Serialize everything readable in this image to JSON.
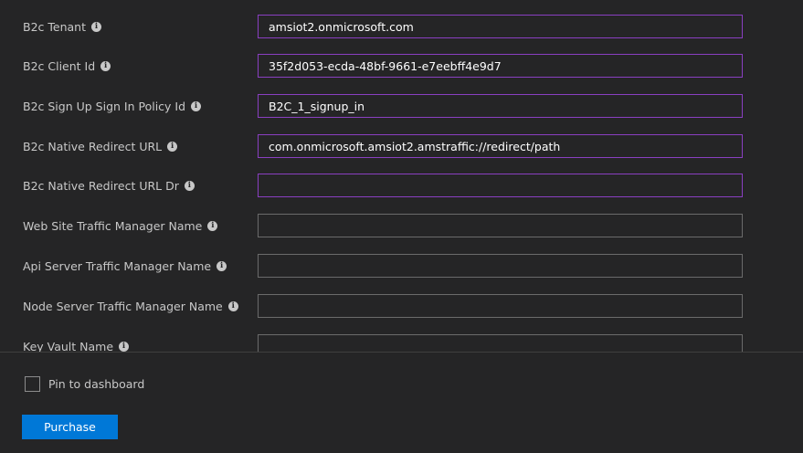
{
  "form": {
    "fields": [
      {
        "label": "B2c Tenant",
        "value": "amsiot2.onmicrosoft.com",
        "info_icon": "info-icon"
      },
      {
        "label": "B2c Client Id",
        "value": "35f2d053-ecda-48bf-9661-e7eebff4e9d7",
        "info_icon": "info-icon"
      },
      {
        "label": "B2c Sign Up Sign In Policy Id",
        "value": "B2C_1_signup_in",
        "info_icon": "info-icon"
      },
      {
        "label": "B2c Native Redirect URL",
        "value": "com.onmicrosoft.amsiot2.amstraffic://redirect/path",
        "info_icon": "info-icon"
      },
      {
        "label": "B2c Native Redirect URL Dr",
        "value": "",
        "info_icon": "info-icon"
      },
      {
        "label": "Web Site Traffic Manager Name",
        "value": "",
        "info_icon": "info-icon"
      },
      {
        "label": "Api Server Traffic Manager Name",
        "value": "",
        "info_icon": "info-icon"
      },
      {
        "label": "Node Server Traffic Manager Name",
        "value": "",
        "info_icon": "info-icon"
      },
      {
        "label": "Key Vault Name",
        "value": "",
        "info_icon": "info-icon"
      }
    ]
  },
  "footer": {
    "pin_label": "Pin to dashboard",
    "pin_checked": false,
    "purchase_label": "Purchase"
  },
  "colors": {
    "background": "#252526",
    "active_border": "#8a3fc1",
    "inactive_border": "#6b6b6b",
    "primary_button": "#0078d7"
  }
}
